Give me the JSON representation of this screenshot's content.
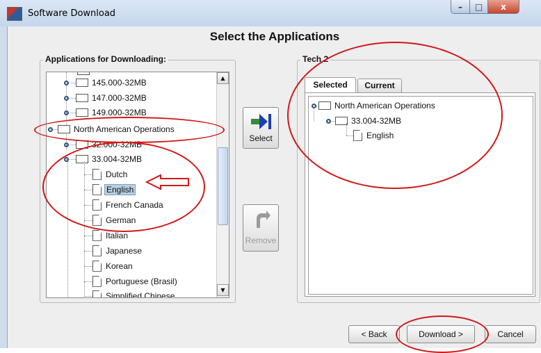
{
  "window": {
    "title": "Software Download",
    "controls": {
      "minimize": "–",
      "maximize": "□",
      "close": "x"
    }
  },
  "heading": "Select the Applications",
  "left_panel": {
    "legend": "Applications for Downloading:",
    "tree": [
      {
        "label": "145.000-32MB",
        "kind": "folder"
      },
      {
        "label": "147.000-32MB",
        "kind": "folder"
      },
      {
        "label": "149.000-32MB",
        "kind": "folder"
      },
      {
        "label": "North American Operations",
        "kind": "folder"
      },
      {
        "label": "32.000-32MB",
        "kind": "folder"
      },
      {
        "label": "33.004-32MB",
        "kind": "folder"
      },
      {
        "label": "Dutch",
        "kind": "doc"
      },
      {
        "label": "English",
        "kind": "doc",
        "selected": true
      },
      {
        "label": "French Canada",
        "kind": "doc"
      },
      {
        "label": "German",
        "kind": "doc"
      },
      {
        "label": "Italian",
        "kind": "doc"
      },
      {
        "label": "Japanese",
        "kind": "doc"
      },
      {
        "label": "Korean",
        "kind": "doc"
      },
      {
        "label": "Portuguese (Brasil)",
        "kind": "doc"
      },
      {
        "label": "Simplified Chinese",
        "kind": "doc"
      }
    ],
    "scroll_position": 0.45
  },
  "middle": {
    "select_label": "Select",
    "remove_label": "Remove"
  },
  "right_panel": {
    "legend": "Tech 2",
    "tabs": [
      {
        "label": "Selected",
        "active": true
      },
      {
        "label": "Current",
        "active": false
      }
    ],
    "tree": [
      {
        "label": "North American Operations",
        "kind": "folder"
      },
      {
        "label": "33.004-32MB",
        "kind": "folder"
      },
      {
        "label": "English",
        "kind": "doc"
      }
    ]
  },
  "footer": {
    "back_label": "< Back",
    "download_label": "Download >",
    "cancel_label": "Cancel"
  },
  "colors": {
    "annotation_red": "#d01818",
    "selection_highlight": "#b8cfe5",
    "select_arrow_blue": "#1a3fb0"
  }
}
